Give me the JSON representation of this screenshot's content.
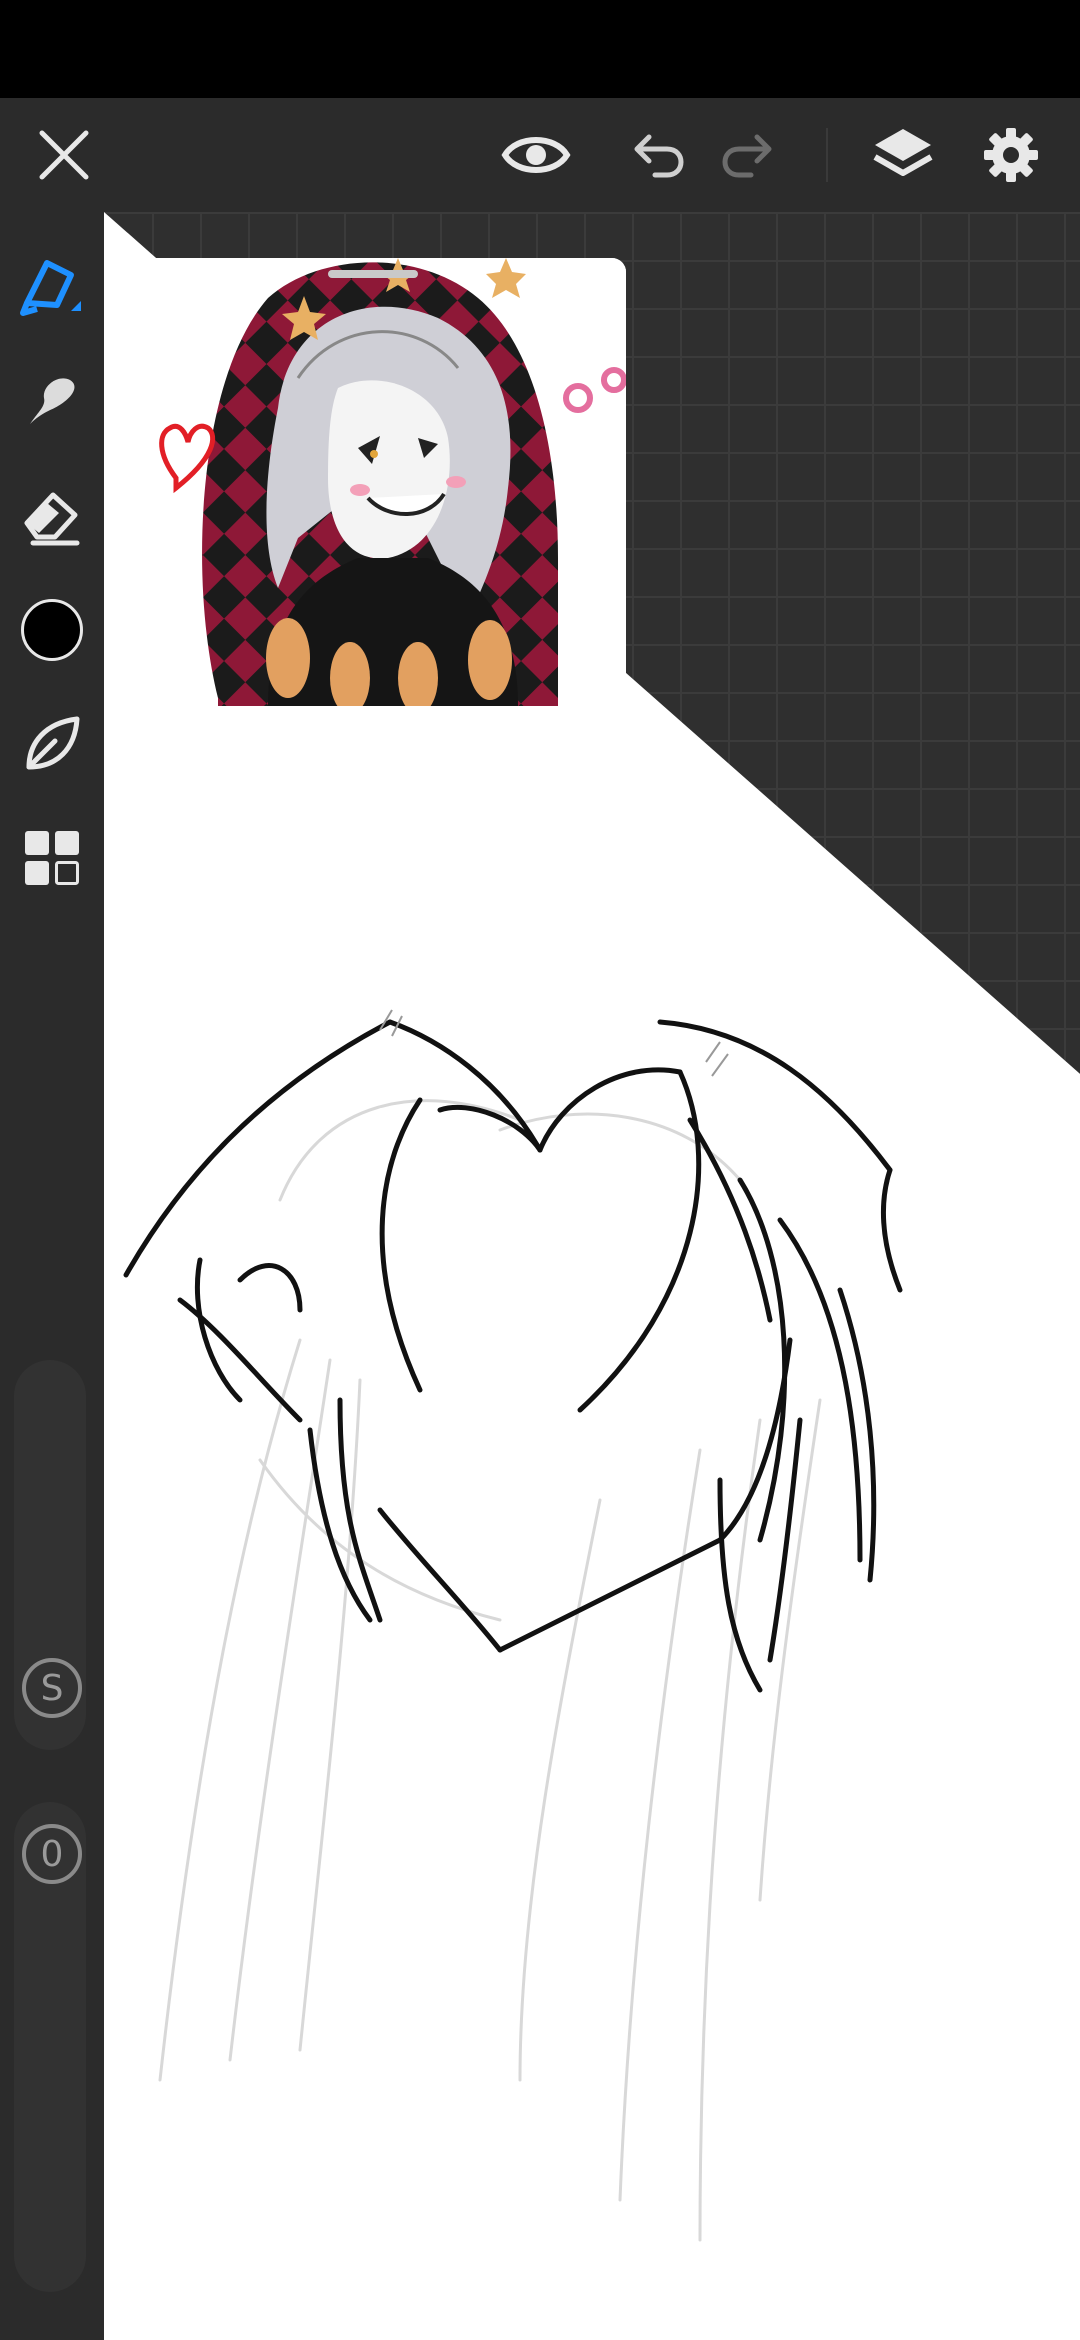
{
  "app": {
    "name": "drawing-app-canvas"
  },
  "top_toolbar": {
    "buttons": [
      {
        "id": "close",
        "icon": "close-icon"
      },
      {
        "id": "preview",
        "icon": "eye-icon"
      },
      {
        "id": "undo",
        "icon": "undo-icon"
      },
      {
        "id": "redo",
        "icon": "redo-icon"
      },
      {
        "id": "layers",
        "icon": "layers-icon"
      },
      {
        "id": "settings",
        "icon": "gear-icon"
      }
    ]
  },
  "side_toolbar": {
    "tools": [
      {
        "id": "pen",
        "icon": "pen-icon",
        "active": true
      },
      {
        "id": "smudge",
        "icon": "smudge-icon"
      },
      {
        "id": "eraser",
        "icon": "eraser-icon"
      },
      {
        "id": "color",
        "icon": "color-swatch",
        "color": "#000000"
      },
      {
        "id": "brush-library",
        "icon": "leaf-icon"
      },
      {
        "id": "more-tools",
        "icon": "grid-icon"
      }
    ],
    "size_label": "S",
    "opacity_label": "0"
  },
  "colors": {
    "accent": "#1e90ff",
    "toolbar_bg": "#2b2b2b",
    "canvas_bg": "#2f2f2f",
    "paper": "#ffffff"
  },
  "reference_window": {
    "icon": "reference-image"
  }
}
